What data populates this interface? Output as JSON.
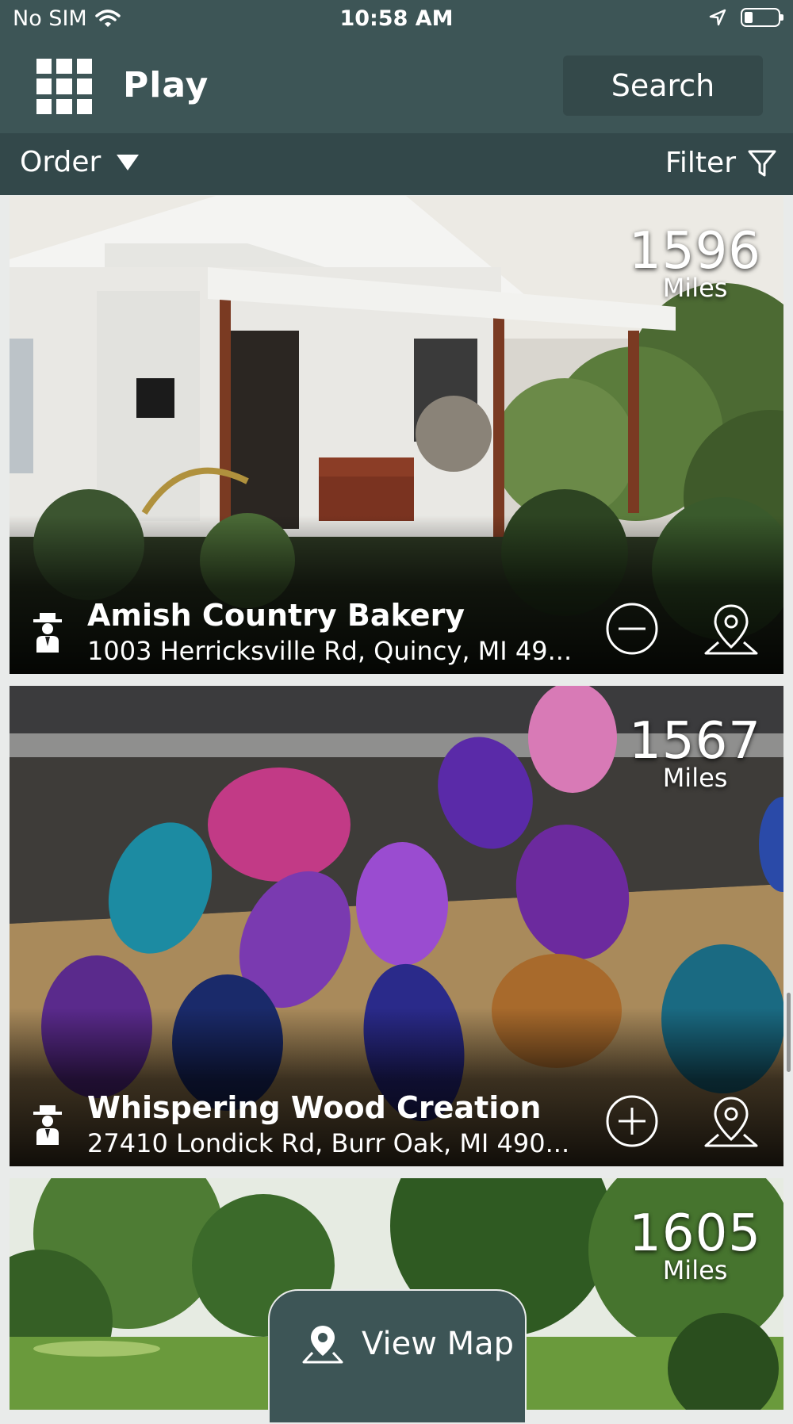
{
  "status_bar": {
    "carrier": "No SIM",
    "time": "10:58 AM"
  },
  "header": {
    "title": "Play",
    "search_label": "Search"
  },
  "toolbar": {
    "order_label": "Order",
    "filter_label": "Filter"
  },
  "cards": [
    {
      "name": "Amish Country Bakery",
      "address": "1003 Herricksville Rd, Quincy, MI 49...",
      "distance": "1596",
      "unit": "Miles",
      "favorite_state": "remove"
    },
    {
      "name": "Whispering Wood Creation",
      "address": "27410 Londick Rd, Burr Oak, MI 490...",
      "distance": "1567",
      "unit": "Miles",
      "favorite_state": "add"
    },
    {
      "distance": "1605",
      "unit": "Miles"
    }
  ],
  "view_map": {
    "label": "View Map"
  },
  "colors": {
    "primary": "#3d5556",
    "toolbar": "#33484a",
    "search_bg": "#34494a",
    "background": "#e9ebea"
  }
}
